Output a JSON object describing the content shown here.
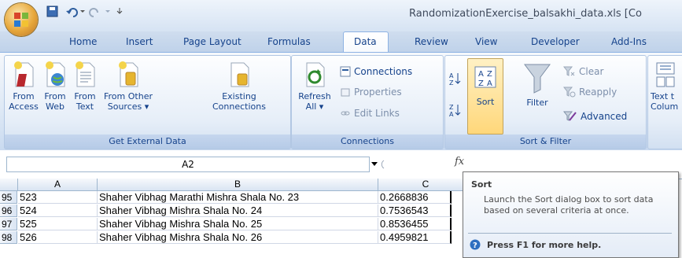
{
  "window": {
    "title": "RandomizationExercise_balsakhi_data.xls  [Co"
  },
  "tabs": [
    "Home",
    "Insert",
    "Page Layout",
    "Formulas",
    "Data",
    "Review",
    "View",
    "Developer",
    "Add-Ins"
  ],
  "active_tab": "Data",
  "ribbon": {
    "get_external": {
      "label": "Get External Data",
      "from_access": [
        "From",
        "Access"
      ],
      "from_web": [
        "From",
        "Web"
      ],
      "from_text": [
        "From",
        "Text"
      ],
      "from_other": [
        "From Other",
        "Sources ▾"
      ],
      "existing": [
        "Existing",
        "Connections"
      ]
    },
    "connections": {
      "label": "Connections",
      "refresh": [
        "Refresh",
        "All ▾"
      ],
      "connections": "Connections",
      "properties": "Properties",
      "edit_links": "Edit Links"
    },
    "sort_filter": {
      "label": "Sort & Filter",
      "sort": "Sort",
      "filter": "Filter",
      "clear": "Clear",
      "reapply": "Reapply",
      "advanced": "Advanced"
    },
    "text_to_columns": [
      "Text t",
      "Colum"
    ]
  },
  "formula_bar": {
    "name_box": "A2",
    "fx": "fx"
  },
  "grid": {
    "columns": [
      "A",
      "B",
      "C"
    ],
    "rows": [
      {
        "num": "95",
        "a": "523",
        "b": "Shaher Vibhag Marathi Mishra Shala No. 23",
        "c": "0.2668836"
      },
      {
        "num": "96",
        "a": "524",
        "b": "Shaher Vibhag Mishra Shala No. 24",
        "c": "0.7536543"
      },
      {
        "num": "97",
        "a": "525",
        "b": "Shaher Vibhag Mishra Shala No. 25",
        "c": "0.8536455"
      },
      {
        "num": "98",
        "a": "526",
        "b": "Shaher Vibhag Mishra Shala No. 26",
        "c": "0.4959821"
      }
    ]
  },
  "tooltip": {
    "title": "Sort",
    "body": "Launch the Sort dialog box to sort data based on several criteria at once.",
    "help": "Press F1 for more help."
  }
}
